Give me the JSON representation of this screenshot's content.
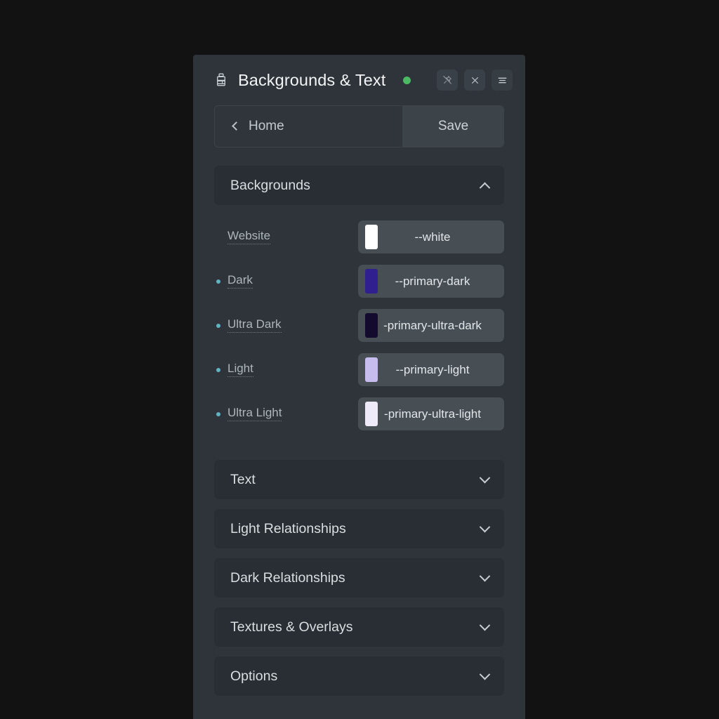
{
  "window": {
    "background_color": "#121212",
    "panel_color": "#2e3439"
  },
  "titlebar": {
    "icon": "paint-brush-icon",
    "title": "Backgrounds & Text",
    "status_dot_color": "#4cb963",
    "buttons": [
      {
        "name": "unpin-icon",
        "label": "Unpin"
      },
      {
        "name": "close-icon",
        "label": "Close"
      },
      {
        "name": "menu-icon",
        "label": "Menu"
      }
    ]
  },
  "nav": {
    "back_icon": "chevron-left-icon",
    "home_label": "Home",
    "save_label": "Save"
  },
  "sections": [
    {
      "label": "Backgrounds",
      "expanded": true,
      "chevron": "chevron-up-icon",
      "rows": [
        {
          "label": "Website",
          "has_bullet": false,
          "swatch_color": "#ffffff",
          "value": "--white"
        },
        {
          "label": "Dark",
          "has_bullet": true,
          "swatch_color": "#2f1f8f",
          "value": "--primary-dark"
        },
        {
          "label": "Ultra Dark",
          "has_bullet": true,
          "swatch_color": "#140a2e",
          "value": "-primary-ultra-dark"
        },
        {
          "label": "Light",
          "has_bullet": true,
          "swatch_color": "#c6bdee",
          "value": "--primary-light"
        },
        {
          "label": "Ultra Light",
          "has_bullet": true,
          "swatch_color": "#eeeaf9",
          "value": "-primary-ultra-light"
        }
      ]
    },
    {
      "label": "Text",
      "expanded": false,
      "chevron": "chevron-down-icon"
    },
    {
      "label": "Light Relationships",
      "expanded": false,
      "chevron": "chevron-down-icon"
    },
    {
      "label": "Dark Relationships",
      "expanded": false,
      "chevron": "chevron-down-icon"
    },
    {
      "label": "Textures & Overlays",
      "expanded": false,
      "chevron": "chevron-down-icon"
    },
    {
      "label": "Options",
      "expanded": false,
      "chevron": "chevron-down-icon"
    }
  ],
  "colors": {
    "bullet": "#5fb3c4",
    "accent_green": "#4cb963"
  }
}
